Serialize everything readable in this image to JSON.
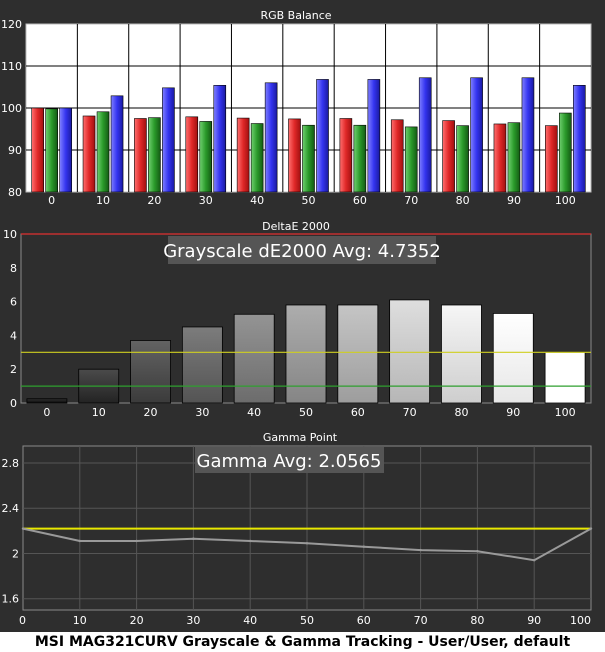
{
  "caption": "MSI MAG321CURV Grayscale & Gamma Tracking - User/User, default",
  "chart_data": [
    {
      "type": "bar",
      "title": "RGB Balance",
      "categories": [
        "0",
        "10",
        "20",
        "30",
        "40",
        "50",
        "60",
        "70",
        "80",
        "90",
        "100"
      ],
      "ylim": [
        80,
        120
      ],
      "yticks": [
        80,
        90,
        100,
        110,
        120
      ],
      "series": [
        {
          "color": "#e03030",
          "values": [
            100.0,
            98.1,
            97.5,
            97.9,
            97.6,
            97.4,
            97.5,
            97.2,
            97.0,
            96.2,
            95.8
          ]
        },
        {
          "color": "#2ea02e",
          "values": [
            99.8,
            99.1,
            97.7,
            96.8,
            96.3,
            95.9,
            95.9,
            95.5,
            95.8,
            96.5,
            98.8
          ]
        },
        {
          "color": "#3a3aee",
          "values": [
            100.0,
            102.9,
            104.8,
            105.4,
            106.0,
            106.8,
            106.8,
            107.2,
            107.2,
            107.2,
            105.4
          ]
        }
      ]
    },
    {
      "type": "bar",
      "title": "DeltaE 2000",
      "annotation": "Grayscale dE2000 Avg: 4.7352",
      "categories": [
        "0",
        "10",
        "20",
        "30",
        "40",
        "50",
        "60",
        "70",
        "80",
        "90",
        "100"
      ],
      "ylim": [
        0,
        10
      ],
      "yticks": [
        0,
        2,
        4,
        6,
        8,
        10
      ],
      "values": [
        0.25,
        2.0,
        3.7,
        4.5,
        5.25,
        5.8,
        5.8,
        6.1,
        5.8,
        5.3,
        3.0
      ],
      "reference_lines": [
        {
          "value": 1,
          "color": "#2f9f2f"
        },
        {
          "value": 3,
          "color": "#cfcf20"
        },
        {
          "value": 10,
          "color": "#e03030"
        }
      ]
    },
    {
      "type": "line",
      "title": "Gamma Point",
      "annotation": "Gamma Avg: 2.0565",
      "x": [
        0,
        10,
        20,
        30,
        40,
        50,
        60,
        70,
        80,
        90,
        100
      ],
      "y": [
        2.22,
        2.11,
        2.11,
        2.13,
        2.11,
        2.09,
        2.06,
        2.03,
        2.02,
        1.94,
        2.22
      ],
      "xlim": [
        0,
        100
      ],
      "xticks": [
        0,
        10,
        20,
        30,
        40,
        50,
        60,
        70,
        80,
        90,
        100
      ],
      "ylim": [
        1.5,
        2.95
      ],
      "yticks": [
        1.6,
        2,
        2.4,
        2.8
      ],
      "target": 2.22,
      "target_color": "#e8e800",
      "line_color": "#9a9a9a"
    }
  ]
}
